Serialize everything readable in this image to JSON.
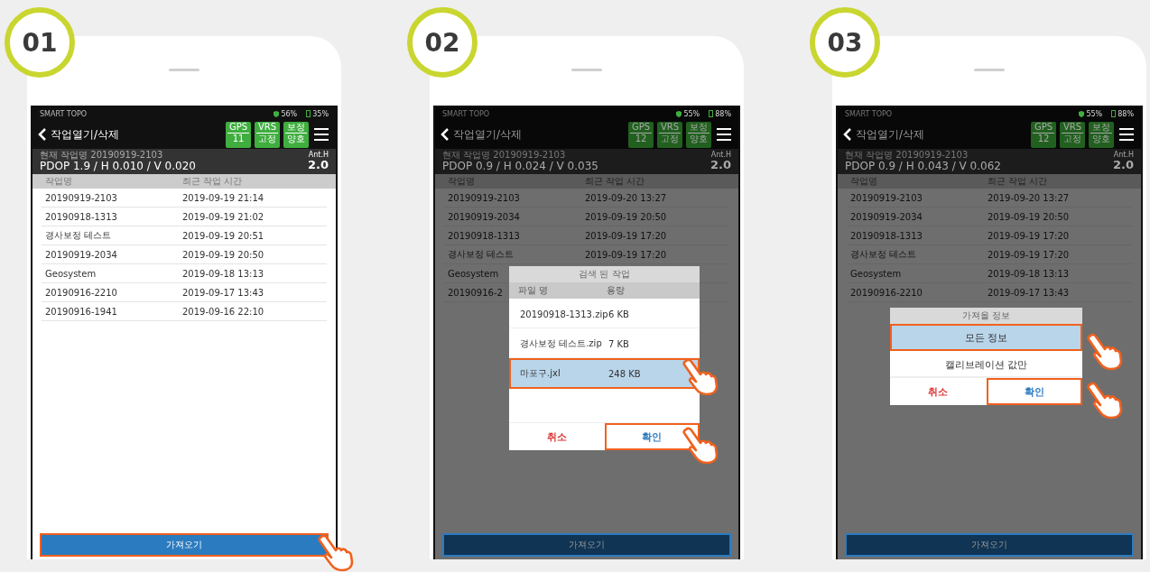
{
  "steps": [
    {
      "number": "01",
      "dimmed": false,
      "status": {
        "app": "SMART TOPO",
        "signal": "56%",
        "battery": "35%"
      },
      "title": "작업열기/삭제",
      "badges": [
        {
          "label": "GPS",
          "value": "11"
        },
        {
          "label": "VRS",
          "value": "고정"
        },
        {
          "label": "보정",
          "value": "양호"
        }
      ],
      "current_job": "현재 작업명 20190919-2103",
      "precision": "PDOP 1.9 / H 0.010 / V 0.020",
      "ant_label": "Ant.H",
      "ant_value": "2.0",
      "columns": [
        "작업명",
        "최근 작업 시간"
      ],
      "rows": [
        {
          "name": "20190919-2103",
          "time": "2019-09-19 21:14"
        },
        {
          "name": "20190918-1313",
          "time": "2019-09-19 21:02"
        },
        {
          "name": "경사보정 테스트",
          "time": "2019-09-19 20:51"
        },
        {
          "name": "20190919-2034",
          "time": "2019-09-19 20:50"
        },
        {
          "name": "Geosystem",
          "time": "2019-09-18 13:13"
        },
        {
          "name": "20190916-2210",
          "time": "2019-09-17 13:43"
        },
        {
          "name": "20190916-1941",
          "time": "2019-09-16 22:10"
        }
      ],
      "import_button": {
        "label": "가져오기",
        "tapped": true
      }
    },
    {
      "number": "02",
      "dimmed": true,
      "status": {
        "app": "SMART TOPO",
        "signal": "55%",
        "battery": "88%"
      },
      "title": "작업열기/삭제",
      "badges": [
        {
          "label": "GPS",
          "value": "12"
        },
        {
          "label": "VRS",
          "value": "고정"
        },
        {
          "label": "보정",
          "value": "양호"
        }
      ],
      "current_job": "현재 작업명 20190919-2103",
      "precision": "PDOP 0.9 / H 0.024 / V 0.035",
      "ant_label": "Ant.H",
      "ant_value": "2.0",
      "columns": [
        "작업명",
        "최근 작업 시간"
      ],
      "rows": [
        {
          "name": "20190919-2103",
          "time": "2019-09-20 13:27"
        },
        {
          "name": "20190919-2034",
          "time": "2019-09-19 20:50"
        },
        {
          "name": "20190918-1313",
          "time": "2019-09-19 17:20"
        },
        {
          "name": "경사보정 테스트",
          "time": "2019-09-19 17:20"
        },
        {
          "name": "Geosystem"
        },
        {
          "name": "20190916-2"
        }
      ],
      "import_button": {
        "label": "가져오기",
        "tapped": false
      },
      "dialog": {
        "kind": "files",
        "title": "검색 된 작업",
        "columns": [
          "파일 명",
          "용량"
        ],
        "items": [
          {
            "name": "20190918-1313.zip",
            "size": "6 KB",
            "selected": false
          },
          {
            "name": "경사보정 테스트.zip",
            "size": "7 KB",
            "selected": false
          },
          {
            "name": "마포구.jxl",
            "size": "248 KB",
            "selected": true
          }
        ],
        "cancel": "취소",
        "confirm": "확인",
        "confirm_tapped": true
      }
    },
    {
      "number": "03",
      "dimmed": true,
      "status": {
        "app": "SMART TOPO",
        "signal": "55%",
        "battery": "88%"
      },
      "title": "작업열기/삭제",
      "badges": [
        {
          "label": "GPS",
          "value": "12"
        },
        {
          "label": "VRS",
          "value": "고정"
        },
        {
          "label": "보정",
          "value": "양호"
        }
      ],
      "current_job": "현재 작업명 20190919-2103",
      "precision": "PDOP 0.9 / H 0.043 / V 0.062",
      "ant_label": "Ant.H",
      "ant_value": "2.0",
      "columns": [
        "작업명",
        "최근 작업 시간"
      ],
      "rows": [
        {
          "name": "20190919-2103",
          "time": "2019-09-20 13:27"
        },
        {
          "name": "20190919-2034",
          "time": "2019-09-19 20:50"
        },
        {
          "name": "20190918-1313",
          "time": "2019-09-19 17:20"
        },
        {
          "name": "경사보정 테스트",
          "time": "2019-09-19 17:20"
        },
        {
          "name": "Geosystem",
          "time": "2019-09-18 13:13"
        },
        {
          "name": "20190916-2210",
          "time": "2019-09-17 13:43"
        }
      ],
      "import_button": {
        "label": "가져오기",
        "tapped": false
      },
      "dialog": {
        "kind": "options",
        "title": "가져올 정보",
        "items": [
          {
            "name": "모든 정보",
            "selected": true
          },
          {
            "name": "캘리브레이션 값만",
            "selected": false
          }
        ],
        "cancel": "취소",
        "confirm": "확인",
        "confirm_tapped": true
      }
    }
  ]
}
